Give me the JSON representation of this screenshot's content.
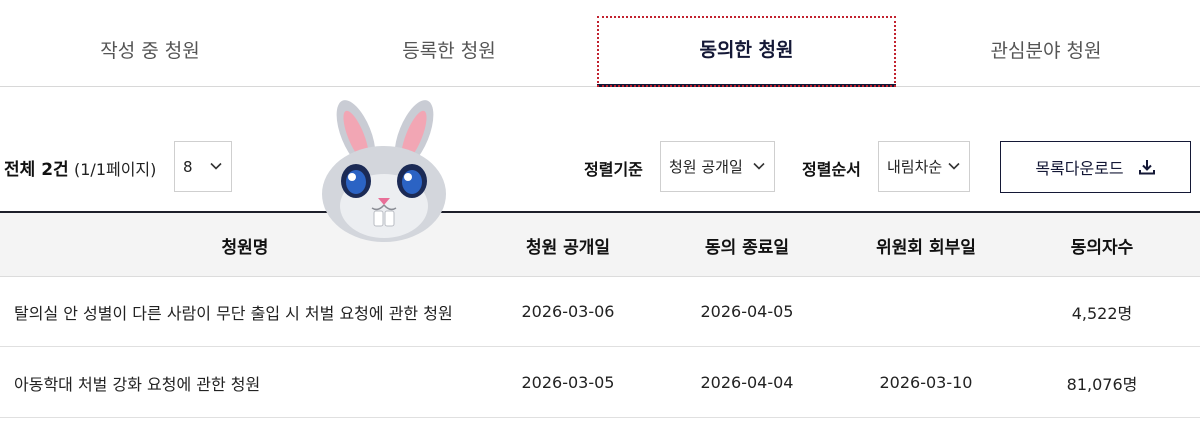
{
  "tabs": [
    {
      "label": "작성 중 청원"
    },
    {
      "label": "등록한 청원"
    },
    {
      "label": "동의한 청원"
    },
    {
      "label": "관심분야 청원"
    }
  ],
  "toolbar": {
    "total": "전체 2건",
    "page_info": "(1/1페이지)",
    "page_size": "8",
    "sort_label": "정렬기준",
    "sort_value": "청원 공개일",
    "order_label": "정렬순서",
    "order_value": "내림차순",
    "download_label": "목록다운로드"
  },
  "table": {
    "headers": [
      "청원명",
      "청원 공개일",
      "동의 종료일",
      "위원회 회부일",
      "동의자수"
    ],
    "rows": [
      {
        "title": "탈의실 안 성별이 다른 사람이 무단 출입 시 처벌 요청에 관한 청원",
        "open_date": "2026-03-06",
        "end_date": "2026-04-05",
        "referral_date": "",
        "count": "4,522명"
      },
      {
        "title": "아동학대 처벌 강화 요청에 관한 청원",
        "open_date": "2026-03-05",
        "end_date": "2026-04-04",
        "referral_date": "2026-03-10",
        "count": "81,076명"
      }
    ]
  },
  "colors": {
    "accent": "#141836",
    "focus_outline": "#c2222f",
    "header_bg": "#f4f4f4"
  },
  "icons": {
    "select": "chevron-down-icon",
    "download": "download-icon",
    "mascot": "rabbit-mascot"
  }
}
